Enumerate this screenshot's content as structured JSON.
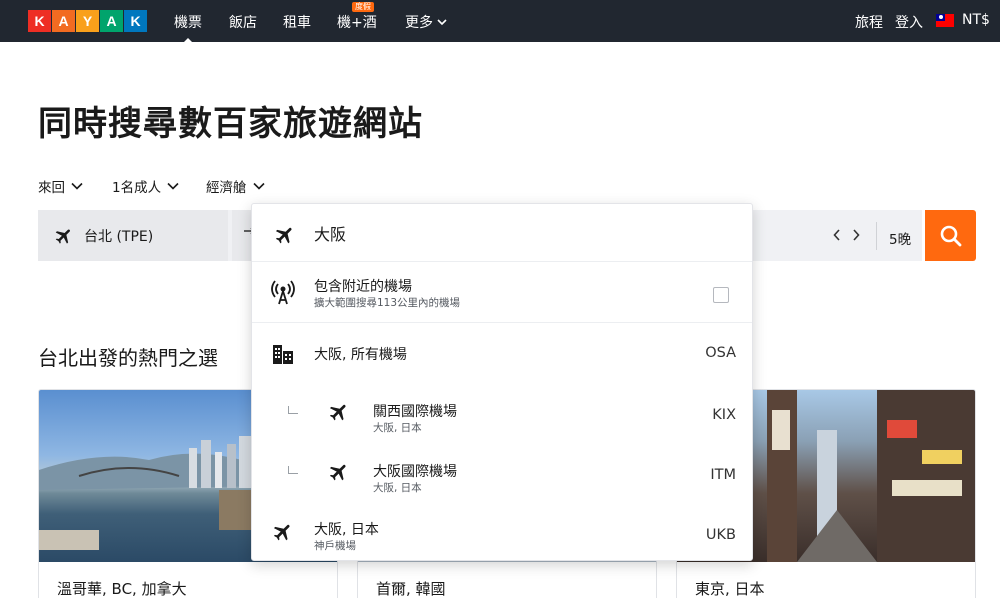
{
  "nav": {
    "logo_letters": [
      "K",
      "A",
      "Y",
      "A",
      "K"
    ],
    "logo_colors": [
      "#ee2e24",
      "#f26b21",
      "#f9a01b",
      "#00a46c",
      "#0077be"
    ],
    "items": [
      {
        "label": "機票",
        "active": true
      },
      {
        "label": "飯店"
      },
      {
        "label": "租車"
      },
      {
        "label": "機+酒",
        "badge": "度假"
      },
      {
        "label": "更多"
      }
    ],
    "trips": "旅程",
    "login": "登入",
    "currency": "NT$"
  },
  "headline": "同時搜尋數百家旅遊網站",
  "options": {
    "trip_type": "來回",
    "travelers": "1名成人",
    "cabin": "經濟艙"
  },
  "search": {
    "origin": "台北 (TPE)",
    "nights": "5晚",
    "prev_icon": "chevron-left-icon",
    "next_icon": "chevron-right-icon",
    "button_icon": "search-icon",
    "button_color": "#ff690f"
  },
  "dropdown": {
    "input_value": "大阪",
    "nearby": {
      "title": "包含附近的機場",
      "subtitle": "擴大範圍搜尋113公里內的機場",
      "checked": false
    },
    "results": [
      {
        "name": "大阪, 所有機場",
        "sub": "",
        "code": "OSA",
        "icon": "city-buildings-icon",
        "nested": false
      },
      {
        "name": "關西國際機場",
        "sub": "大阪, 日本",
        "code": "KIX",
        "icon": "plane-icon",
        "nested": true
      },
      {
        "name": "大阪國際機場",
        "sub": "大阪, 日本",
        "code": "ITM",
        "icon": "plane-icon",
        "nested": true
      },
      {
        "name": "大阪, 日本",
        "sub": "神戶機場",
        "code": "UKB",
        "icon": "plane-icon",
        "nested": false
      }
    ]
  },
  "section_title": "台北出發的熱門之選",
  "cards": [
    {
      "label": "溫哥華, BC, 加拿大"
    },
    {
      "label": "首爾, 韓國"
    },
    {
      "label": "東京, 日本"
    }
  ]
}
